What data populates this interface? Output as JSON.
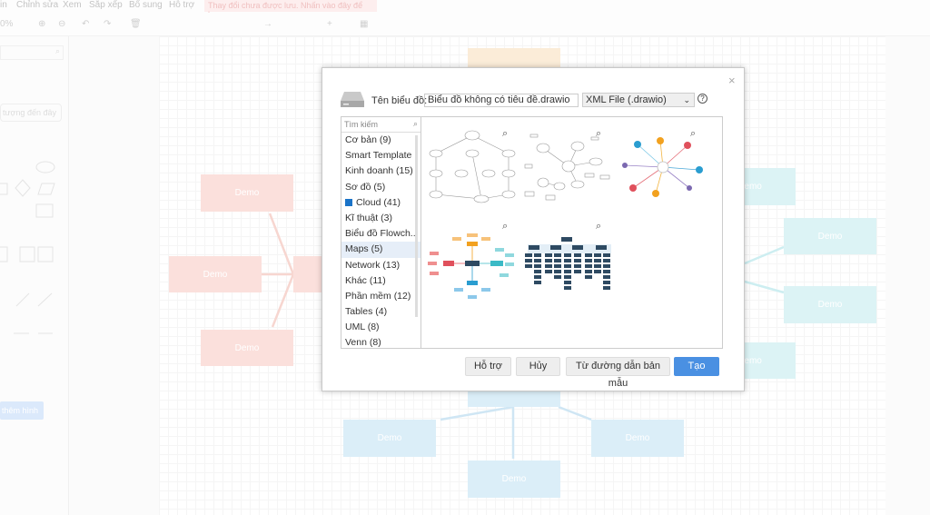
{
  "menu": {
    "items": [
      "in",
      "Chỉnh sửa",
      "Xem",
      "Sắp xếp",
      "Bổ sung",
      "Hỗ trợ"
    ],
    "unsaved": "Thay đổi chưa được lưu. Nhấn vào đây để lưu."
  },
  "toolbar": {
    "zoom": "0%"
  },
  "sidebar": {
    "shape_search_hint": "tượng đến đây",
    "add_shapes": "thêm hình"
  },
  "canvas": {
    "node_label": "Demo"
  },
  "dialog": {
    "name_label": "Tên biểu đồ:",
    "name_value": "Biểu đồ không có tiêu đề.drawio",
    "format": "XML File (.drawio)",
    "search_placeholder": "Tìm kiếm",
    "categories": [
      "Cơ bản (9)",
      "Smart Template",
      "Kinh doanh (15)",
      "Sơ đồ (5)",
      "Cloud (41)",
      "Kĩ thuật (3)",
      "Biểu đồ Flowch...",
      "Maps (5)",
      "Network (13)",
      "Khác (11)",
      "Phần mềm (12)",
      "Tables (4)",
      "UML (8)",
      "Venn (8)"
    ],
    "selected_category": "Maps (5)",
    "buttons": {
      "help": "Hỗ trợ",
      "cancel": "Hủy",
      "from_url": "Từ đường dẫn bản mẫu",
      "create": "Tạo"
    },
    "accent": "#4a90e2"
  }
}
